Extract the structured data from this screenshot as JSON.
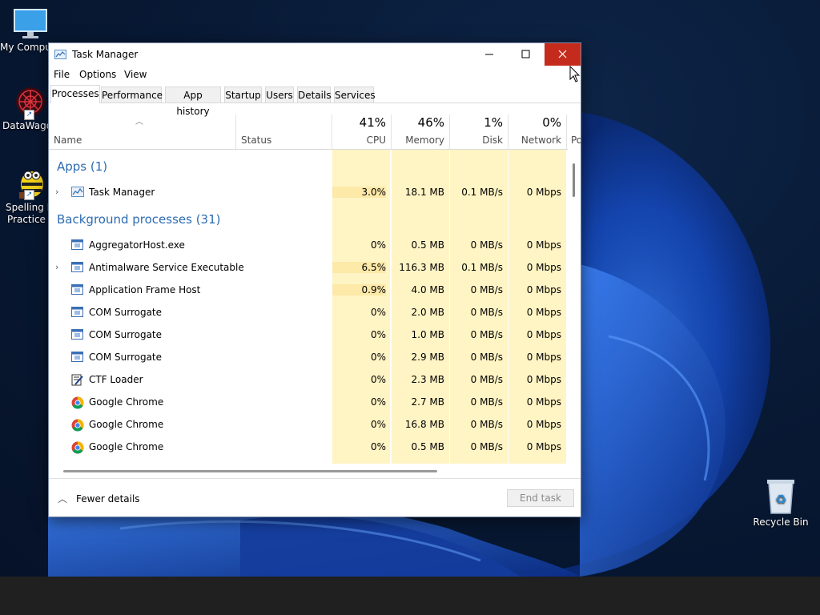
{
  "desktop": {
    "icons": [
      {
        "label": "My Compu",
        "name": "this-pc"
      },
      {
        "label": "DataWagor",
        "name": "datawagon"
      },
      {
        "label_line1": "Spelling B",
        "label_line2": "Practice S",
        "name": "spelling-bee"
      },
      {
        "label": "Recycle Bin",
        "name": "recycle-bin"
      }
    ]
  },
  "window": {
    "title": "Task Manager",
    "menu": [
      "File",
      "Options",
      "View"
    ],
    "tabs": [
      "Processes",
      "Performance",
      "App history",
      "Startup",
      "Users",
      "Details",
      "Services"
    ],
    "active_tab": "Processes"
  },
  "columns": {
    "name": "Name",
    "status": "Status",
    "cpu": {
      "pct": "41%",
      "label": "CPU"
    },
    "memory": {
      "pct": "46%",
      "label": "Memory"
    },
    "disk": {
      "pct": "1%",
      "label": "Disk"
    },
    "network": {
      "pct": "0%",
      "label": "Network"
    },
    "power": "Po"
  },
  "groups": {
    "apps": "Apps (1)",
    "background": "Background processes (31)"
  },
  "apps": [
    {
      "name": "Task Manager",
      "cpu": "3.0%",
      "memory": "18.1 MB",
      "disk": "0.1 MB/s",
      "network": "0 Mbps",
      "expandable": true,
      "icon": "taskmgr-icon"
    }
  ],
  "processes": [
    {
      "name": "AggregatorHost.exe",
      "cpu": "0%",
      "memory": "0.5 MB",
      "disk": "0 MB/s",
      "network": "0 Mbps",
      "expandable": false,
      "icon": "process-icon"
    },
    {
      "name": "Antimalware Service Executable",
      "cpu": "6.5%",
      "memory": "116.3 MB",
      "disk": "0.1 MB/s",
      "network": "0 Mbps",
      "expandable": true,
      "icon": "process-icon"
    },
    {
      "name": "Application Frame Host",
      "cpu": "0.9%",
      "memory": "4.0 MB",
      "disk": "0 MB/s",
      "network": "0 Mbps",
      "expandable": false,
      "icon": "process-icon"
    },
    {
      "name": "COM Surrogate",
      "cpu": "0%",
      "memory": "2.0 MB",
      "disk": "0 MB/s",
      "network": "0 Mbps",
      "expandable": false,
      "icon": "process-icon"
    },
    {
      "name": "COM Surrogate",
      "cpu": "0%",
      "memory": "1.0 MB",
      "disk": "0 MB/s",
      "network": "0 Mbps",
      "expandable": false,
      "icon": "process-icon"
    },
    {
      "name": "COM Surrogate",
      "cpu": "0%",
      "memory": "2.9 MB",
      "disk": "0 MB/s",
      "network": "0 Mbps",
      "expandable": false,
      "icon": "process-icon"
    },
    {
      "name": "CTF Loader",
      "cpu": "0%",
      "memory": "2.3 MB",
      "disk": "0 MB/s",
      "network": "0 Mbps",
      "expandable": false,
      "icon": "ctf-icon"
    },
    {
      "name": "Google Chrome",
      "cpu": "0%",
      "memory": "2.7 MB",
      "disk": "0 MB/s",
      "network": "0 Mbps",
      "expandable": false,
      "icon": "chrome-icon"
    },
    {
      "name": "Google Chrome",
      "cpu": "0%",
      "memory": "16.8 MB",
      "disk": "0 MB/s",
      "network": "0 Mbps",
      "expandable": false,
      "icon": "chrome-icon"
    },
    {
      "name": "Google Chrome",
      "cpu": "0%",
      "memory": "0.5 MB",
      "disk": "0 MB/s",
      "network": "0 Mbps",
      "expandable": false,
      "icon": "chrome-icon"
    }
  ],
  "footer": {
    "fewer_details": "Fewer details",
    "end_task": "End task"
  },
  "colors": {
    "close_button": "#c42b1c",
    "group_text": "#2e6cb1",
    "heat_light": "#fff4c4",
    "heat_medium": "#fde9a8"
  }
}
